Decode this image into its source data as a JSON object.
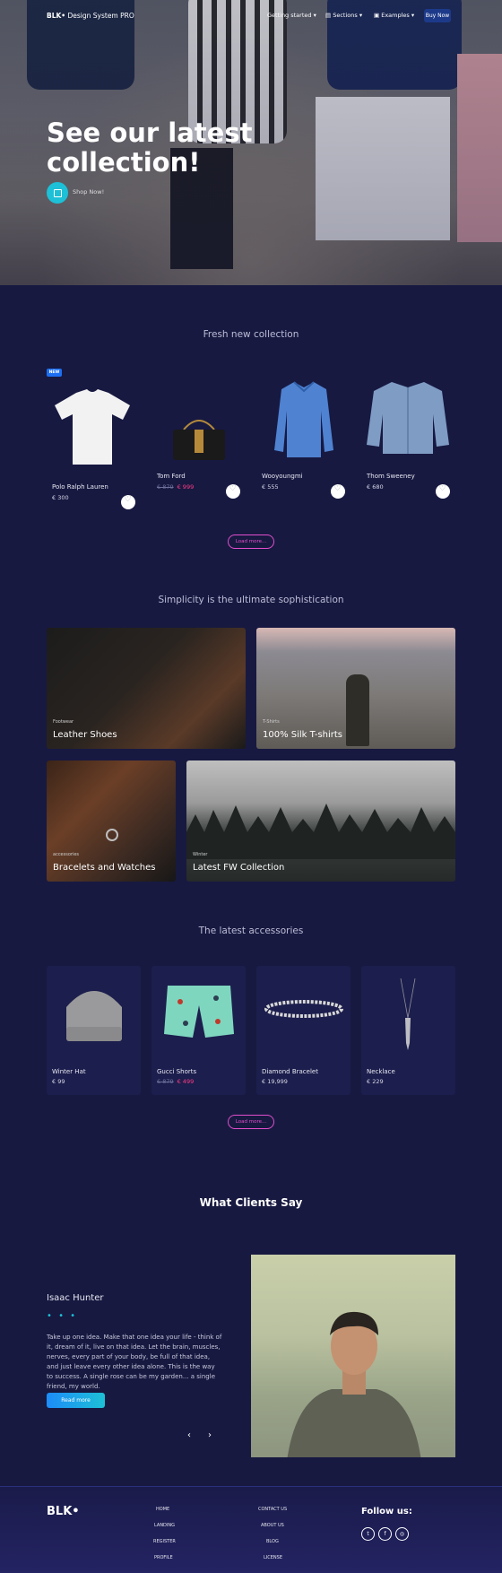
{
  "nav": {
    "brand_bold": "BLK•",
    "brand_rest": " Design System PRO",
    "getting_started": "Getting started",
    "sections": "Sections",
    "examples": "Examples",
    "buy_now": "Buy Now"
  },
  "hero": {
    "title": "See our latest collection!",
    "cta": "Shop Now!"
  },
  "fresh": {
    "title": "Fresh new collection",
    "badge": "NEW",
    "load_more": "Load more...",
    "products": [
      {
        "name": "Polo Ralph Lauren",
        "price": "€ 300"
      },
      {
        "name": "Tom Ford",
        "old_price": "€ 879",
        "price": "€ 999"
      },
      {
        "name": "Wooyoungmi",
        "price": "€ 555"
      },
      {
        "name": "Thom Sweeney",
        "price": "€ 680"
      }
    ]
  },
  "categories": {
    "title": "Simplicity is the ultimate sophistication",
    "items": [
      {
        "tag": "Footwear",
        "name": "Leather Shoes"
      },
      {
        "tag": "T-Shirts",
        "name": "100% Silk T-shirts"
      },
      {
        "tag": "accessories",
        "name": "Bracelets and Watches"
      },
      {
        "tag": "Winter",
        "name": "Latest FW Collection"
      }
    ]
  },
  "accessories": {
    "title": "The latest accessories",
    "load_more": "Load more...",
    "items": [
      {
        "name": "Winter Hat",
        "price": "€ 99"
      },
      {
        "name": "Gucci Shorts",
        "old_price": "€ 879",
        "price": "€ 499"
      },
      {
        "name": "Diamond Bracelet",
        "price": "€ 19,999"
      },
      {
        "name": "Necklace",
        "price": "€ 229"
      }
    ]
  },
  "testimonial": {
    "title": "What Clients Say",
    "name": "Isaac Hunter",
    "dots": "• • •",
    "text": "Take up one idea. Make that one idea your life - think of it, dream of it, live on that idea. Let the brain, muscles, nerves, every part of your body, be full of that idea, and just leave every other idea alone. This is the way to success. A single rose can be my garden... a single friend, my world.",
    "button": "Read more",
    "prev": "‹",
    "next": "›"
  },
  "footer": {
    "logo": "BLK•",
    "col1": [
      "HOME",
      "LANDING",
      "REGISTER",
      "PROFILE"
    ],
    "col2": [
      "CONTACT US",
      "ABOUT US",
      "BLOG",
      "LICENSE"
    ],
    "follow": "Follow us:",
    "social": [
      "twitter-icon",
      "facebook-icon",
      "dribbble-icon"
    ]
  },
  "colors": {
    "background": "#171941",
    "accent_pink": "#e14eca",
    "accent_cyan": "#1dc0d6",
    "sale_red": "#ff3c84"
  }
}
